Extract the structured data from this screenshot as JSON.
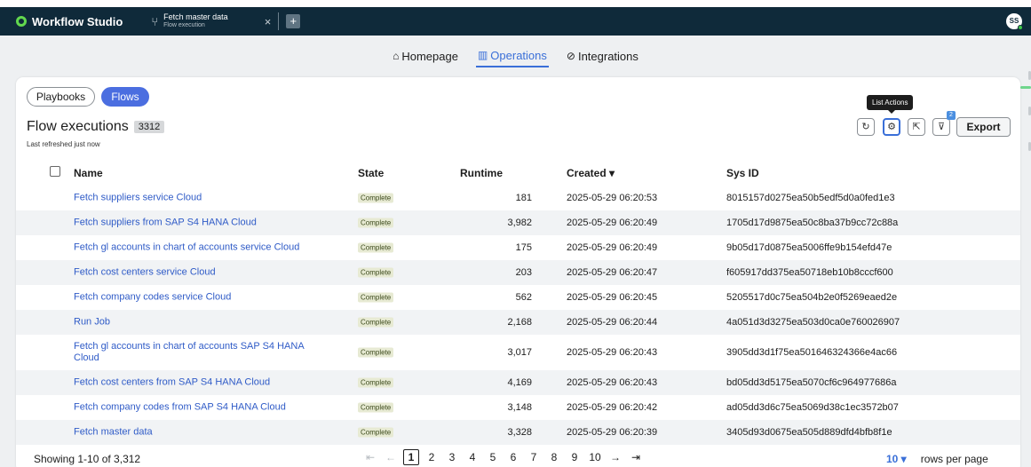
{
  "titlebar": {
    "app_title": "Workflow Studio",
    "tab_title": "Fetch master data",
    "tab_subtitle": "Flow execution",
    "tab_close": "×",
    "tab_add": "+",
    "user_initials": "SS"
  },
  "nav": {
    "items": [
      {
        "label": "Homepage",
        "icon": "home-icon",
        "active": false
      },
      {
        "label": "Operations",
        "icon": "chart-icon",
        "active": true
      },
      {
        "label": "Integrations",
        "icon": "link-icon",
        "active": false
      }
    ]
  },
  "filters": {
    "playbooks": "Playbooks",
    "flows": "Flows"
  },
  "header": {
    "title": "Flow executions",
    "count": "3312",
    "refreshed": "Last refreshed just now"
  },
  "toolbar": {
    "tooltip": "List Actions",
    "filter_count": "2",
    "export": "Export"
  },
  "table": {
    "columns": {
      "name": "Name",
      "state": "State",
      "runtime": "Runtime",
      "created": "Created ▾",
      "sysid": "Sys ID"
    },
    "rows": [
      {
        "name": "Fetch suppliers service Cloud",
        "state": "Complete",
        "runtime": "181",
        "created": "2025-05-29 06:20:53",
        "sysid": "8015157d0275ea50b5edf5d0a0fed1e3"
      },
      {
        "name": "Fetch suppliers from SAP S4 HANA Cloud",
        "state": "Complete",
        "runtime": "3,982",
        "created": "2025-05-29 06:20:49",
        "sysid": "1705d17d9875ea50c8ba37b9cc72c88a"
      },
      {
        "name": "Fetch gl accounts in chart of accounts service Cloud",
        "state": "Complete",
        "runtime": "175",
        "created": "2025-05-29 06:20:49",
        "sysid": "9b05d17d0875ea5006ffe9b154efd47e"
      },
      {
        "name": "Fetch cost centers service Cloud",
        "state": "Complete",
        "runtime": "203",
        "created": "2025-05-29 06:20:47",
        "sysid": "f605917dd375ea50718eb10b8cccf600"
      },
      {
        "name": "Fetch company codes service Cloud",
        "state": "Complete",
        "runtime": "562",
        "created": "2025-05-29 06:20:45",
        "sysid": "5205517d0c75ea504b2e0f5269eaed2e"
      },
      {
        "name": "Run Job",
        "state": "Complete",
        "runtime": "2,168",
        "created": "2025-05-29 06:20:44",
        "sysid": "4a051d3d3275ea503d0ca0e760026907"
      },
      {
        "name": "Fetch gl accounts in chart of accounts SAP S4 HANA Cloud",
        "state": "Complete",
        "runtime": "3,017",
        "created": "2025-05-29 06:20:43",
        "sysid": "3905dd3d1f75ea501646324366e4ac66"
      },
      {
        "name": "Fetch cost centers from SAP S4 HANA Cloud",
        "state": "Complete",
        "runtime": "4,169",
        "created": "2025-05-29 06:20:43",
        "sysid": "bd05dd3d5175ea5070cf6c964977686a"
      },
      {
        "name": "Fetch company codes from SAP S4 HANA Cloud",
        "state": "Complete",
        "runtime": "3,148",
        "created": "2025-05-29 06:20:42",
        "sysid": "ad05dd3d6c75ea5069d38c1ec3572b07"
      },
      {
        "name": "Fetch master data",
        "state": "Complete",
        "runtime": "3,328",
        "created": "2025-05-29 06:20:39",
        "sysid": "3405d93d0675ea505d889dfd4bfb8f1e"
      }
    ]
  },
  "footer": {
    "showing": "Showing 1-10 of 3,312",
    "first": "⇤",
    "prev": "←",
    "pages": [
      "1",
      "2",
      "3",
      "4",
      "5",
      "6",
      "7",
      "8",
      "9",
      "10"
    ],
    "next": "→",
    "last": "⇥",
    "rows_per_page_value": "10 ▾",
    "rows_per_page_label": "rows per page"
  },
  "colors": {
    "titlebar": "#0f2a3a",
    "accent": "#3a6fd8",
    "flows_pill": "#4b6ee0",
    "link": "#2f5bc7",
    "complete_badge": "#e7ead3"
  }
}
